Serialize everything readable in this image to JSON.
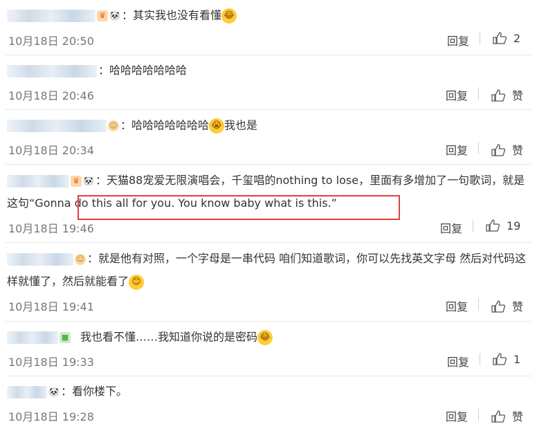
{
  "comments": [
    {
      "text": "：其实我也没有看懂",
      "date": "10月18日 20:50",
      "reply_label": "回复",
      "like_label": "2",
      "emoji_icon": "laughing-tears-icon"
    },
    {
      "text": "：哈哈哈哈哈哈哈",
      "date": "10月18日 20:46",
      "reply_label": "回复",
      "like_label": "赞"
    },
    {
      "text": "：哈哈哈哈哈哈哈",
      "text2": "我也是",
      "date": "10月18日 20:34",
      "reply_label": "回复",
      "like_label": "赞",
      "emoji_icon": "crying-laugh-icon"
    },
    {
      "text": "：天猫88宠爱无限演唱会，千玺唱的nothing to lose，里面有多增加了一句歌词，就是这句“Gonna do this all for you. You know baby what is this.”",
      "date": "10月18日 19:46",
      "reply_label": "回复",
      "like_label": "19"
    },
    {
      "text": "：就是他有对照，一个字母是一串代码 咱们知道歌词，你可以先找英文字母 然后对代码这样就懂了，然后就能看了",
      "date": "10月18日 19:41",
      "reply_label": "回复",
      "like_label": "赞",
      "emoji_icon": "smile-icon"
    },
    {
      "text": "我也看不懂……我知道你说的是密码",
      "date": "10月18日 19:33",
      "reply_label": "回复",
      "like_label": "1",
      "emoji_icon": "laughing-tears-icon"
    },
    {
      "text": "：看你楼下。",
      "date": "10月18日 19:28",
      "reply_label": "回复",
      "like_label": "赞"
    }
  ],
  "colors": {
    "highlight_border": "#e0403a",
    "date": "#777777",
    "text": "#333333"
  }
}
